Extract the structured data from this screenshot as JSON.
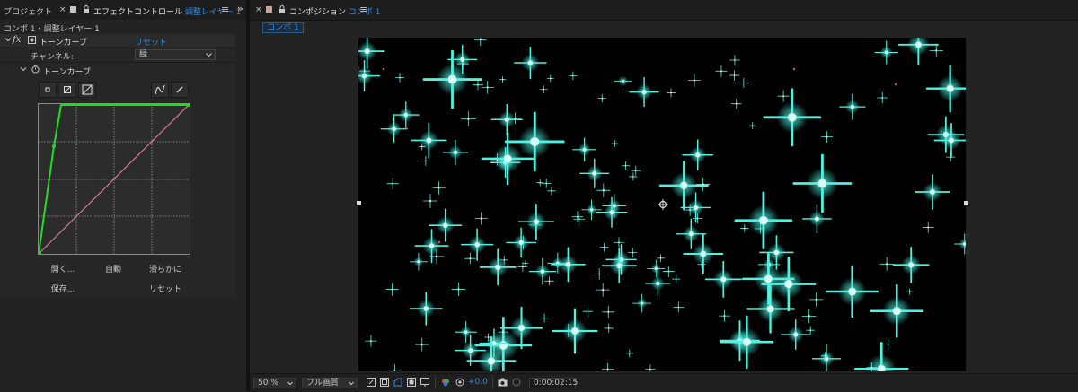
{
  "left_panel": {
    "tab_project": "プロジェクト",
    "tab_close": "×",
    "tab_effect_prefix": "エフェクトコントロール",
    "tab_effect_target": "調整レイヤー 1",
    "tab_menu": "≡",
    "overflow": "»",
    "breadcrumb": "コンポ 1・調整レイヤー 1",
    "effect": {
      "fx_label": "fx",
      "name": "トーンカーブ",
      "reset": "リセット",
      "channel_label": "チャンネル:",
      "channel_value": "緑",
      "sub_name": "トーンカーブ"
    },
    "buttons": {
      "open": "開く...",
      "auto": "自動",
      "smooth": "滑らかに",
      "save": "保存...",
      "reset": "リセット"
    }
  },
  "right_panel": {
    "tab_close": "×",
    "tab_prefix": "コンポジション",
    "tab_comp": "コンポ 1",
    "tab_menu": "≡",
    "comp_chip": "コンポ 1",
    "bottom": {
      "zoom": "50 %",
      "quality": "フル画質",
      "exposure": "+0.0",
      "timecode": "0:00:02:15"
    }
  },
  "colors": {
    "accent": "#2d8ceb",
    "curve_green": "#22dd22",
    "curve_diagonal": "#d07a90",
    "sparkle": "#4ff2e0"
  }
}
